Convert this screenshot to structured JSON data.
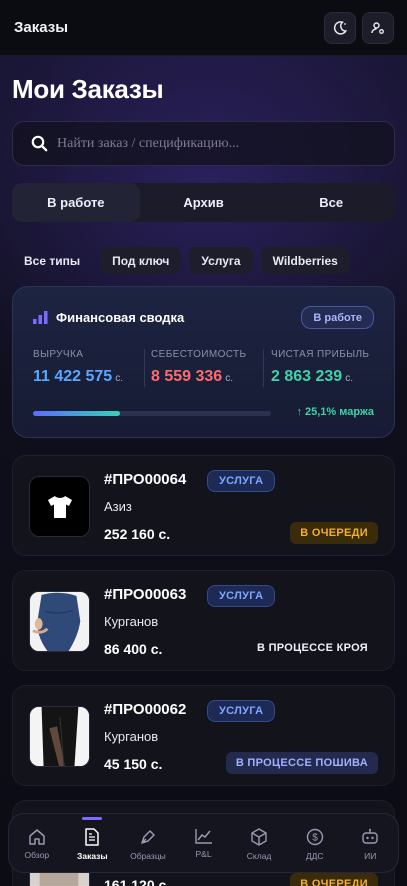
{
  "header": {
    "title": "Заказы",
    "theme_icon": "moon-icon",
    "profile_icon": "user-gear-icon"
  },
  "page_title": "Мои Заказы",
  "search": {
    "placeholder": "Найти заказ / спецификацию..."
  },
  "tabs": [
    {
      "label": "В работе",
      "active": true
    },
    {
      "label": "Архив",
      "active": false
    },
    {
      "label": "Все",
      "active": false
    }
  ],
  "filters": [
    {
      "label": "Все типы",
      "active": true
    },
    {
      "label": "Под ключ",
      "active": false
    },
    {
      "label": "Услуга",
      "active": false
    },
    {
      "label": "Wildberries",
      "active": false
    }
  ],
  "finance": {
    "title": "Финансовая сводка",
    "badge": "В работе",
    "metrics": [
      {
        "label": "ВЫРУЧКА",
        "value": "11 422 575",
        "unit": "с.",
        "color": "#5aa7ff"
      },
      {
        "label": "СЕБЕСТОИМОСТЬ",
        "value": "8 559 336",
        "unit": "с.",
        "color": "#ff6b6b"
      },
      {
        "label": "ЧИСТАЯ ПРИБЫЛЬ",
        "value": "2 863 239",
        "unit": "с.",
        "color": "#3fd3a7"
      }
    ],
    "margin_fraction": 0.251,
    "margin_label": "↑ 25,1% маржа"
  },
  "orders": [
    {
      "id": "#ПРО00064",
      "tag": "УСЛУГА",
      "customer": "Азиз",
      "price": "252 160 с.",
      "status": "В ОЧЕРЕДИ",
      "status_kind": "queue",
      "thumb": "tshirt-icon"
    },
    {
      "id": "#ПРО00063",
      "tag": "УСЛУГА",
      "customer": "Курганов",
      "price": "86 400 с.",
      "status": "В ПРОЦЕССЕ КРОЯ",
      "status_kind": "cut",
      "thumb": "dress-photo"
    },
    {
      "id": "#ПРО00062",
      "tag": "УСЛУГА",
      "customer": "Курганов",
      "price": "45 150 с.",
      "status": "В ПРОЦЕССЕ ПОШИВА",
      "status_kind": "sew",
      "thumb": "skirt-photo"
    },
    {
      "id": "",
      "tag": "",
      "customer": "",
      "price": "161 120 с.",
      "status": "В ОЧЕРЕДИ",
      "status_kind": "queue",
      "thumb": "photo"
    }
  ],
  "nav": [
    {
      "label": "Обзор",
      "icon": "home-icon",
      "active": false
    },
    {
      "label": "Заказы",
      "icon": "document-icon",
      "active": true
    },
    {
      "label": "Образцы",
      "icon": "pen-icon",
      "active": false
    },
    {
      "label": "P&L",
      "icon": "chart-line-icon",
      "active": false
    },
    {
      "label": "Склад",
      "icon": "box-icon",
      "active": false
    },
    {
      "label": "ДДС",
      "icon": "dollar-coin-icon",
      "active": false
    },
    {
      "label": "ИИ",
      "icon": "robot-icon",
      "active": false
    }
  ]
}
